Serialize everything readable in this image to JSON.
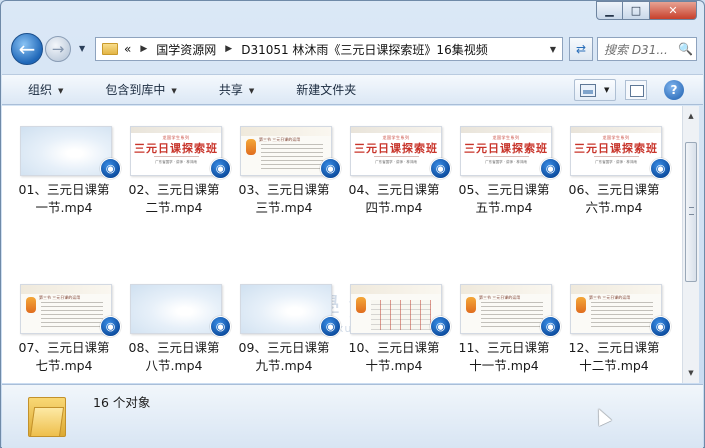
{
  "window": {
    "caption": {
      "minimize": "▁",
      "maximize": "□",
      "close": "✕"
    }
  },
  "nav": {
    "back_icon": "←",
    "forward_icon": "→",
    "recent_icon": "▼",
    "breadcrumb": {
      "overflow": "«",
      "items": [
        "国学资源网",
        "D31051 林沐雨《三元日课探索班》16集视频"
      ],
      "separator": "▶"
    },
    "address_dropdown_icon": "▼",
    "refresh_icon": "⇄",
    "search": {
      "placeholder": "搜索 D31...",
      "icon": "🔍"
    }
  },
  "toolbar": {
    "items": [
      {
        "label": "组织",
        "has_arrow": true
      },
      {
        "label": "包含到库中",
        "has_arrow": true
      },
      {
        "label": "共享",
        "has_arrow": true
      },
      {
        "label": "新建文件夹",
        "has_arrow": false
      }
    ],
    "arrow": "▼",
    "view_arrow": "▼",
    "help": "?"
  },
  "files": [
    {
      "line1": "01、三元日课第",
      "line2": "一节.mp4",
      "thumb": "blank"
    },
    {
      "line1": "02、三元日课第",
      "line2": "二节.mp4",
      "thumb": "title"
    },
    {
      "line1": "03、三元日课第",
      "line2": "三节.mp4",
      "thumb": "doc"
    },
    {
      "line1": "04、三元日课第",
      "line2": "四节.mp4",
      "thumb": "title"
    },
    {
      "line1": "05、三元日课第",
      "line2": "五节.mp4",
      "thumb": "title"
    },
    {
      "line1": "06、三元日课第",
      "line2": "六节.mp4",
      "thumb": "title"
    },
    {
      "line1": "07、三元日课第",
      "line2": "七节.mp4",
      "thumb": "doc"
    },
    {
      "line1": "08、三元日课第",
      "line2": "八节.mp4",
      "thumb": "blank"
    },
    {
      "line1": "09、三元日课第",
      "line2": "九节.mp4",
      "thumb": "blank"
    },
    {
      "line1": "10、三元日课第",
      "line2": "十节.mp4",
      "thumb": "grid"
    },
    {
      "line1": "11、三元日课第",
      "line2": "十一节.mp4",
      "thumb": "doc"
    },
    {
      "line1": "12、三元日课第",
      "line2": "十二节.mp4",
      "thumb": "doc"
    }
  ],
  "thumb_title": {
    "small": "龙国学生系列",
    "big": "三元日课探索班",
    "sub": "广东省国学 · 讲师 · 林沐雨"
  },
  "doc_heading": "第三节 三元日课的运用",
  "badge_icon": "◉",
  "watermark": {
    "seal": "国",
    "text": "國學資源網",
    "url": "www.guoxueziyuan.com"
  },
  "status": {
    "count_text": "16 个对象"
  },
  "colors": {
    "accent": "#1c5eae",
    "title_red": "#c8342a",
    "window_frame": "#cfe0f1"
  }
}
